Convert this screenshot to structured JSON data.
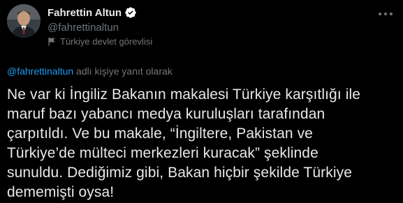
{
  "author": {
    "display_name": "Fahrettin Altun",
    "handle": "@fahrettinaltun",
    "account_label": "Türkiye devlet görevlisi",
    "verified": true,
    "verified_color": "#ffffff",
    "avatar_icon": "profile-photo"
  },
  "reply": {
    "mention": "@fahrettinaltun",
    "suffix": " adlı kişiye yanıt olarak"
  },
  "tweet": {
    "lines": [
      "Ne var ki İngiliz Bakanın makalesi Türkiye karşıtlığı ile",
      "maruf bazı yabancı medya kuruluşları tarafından",
      "çarpıtıldı. Ve bu makale, “İngiltere, Pakistan ve",
      "Türkiye’de mülteci merkezleri kuracak” şeklinde",
      "sunuldu. Dediğimiz gibi, Bakan hiçbir şekilde Türkiye",
      "dememişti oysa!"
    ]
  },
  "colors": {
    "background": "#000000",
    "text": "#e7e9ea",
    "secondary": "#71767b",
    "link": "#1d9bf0"
  }
}
